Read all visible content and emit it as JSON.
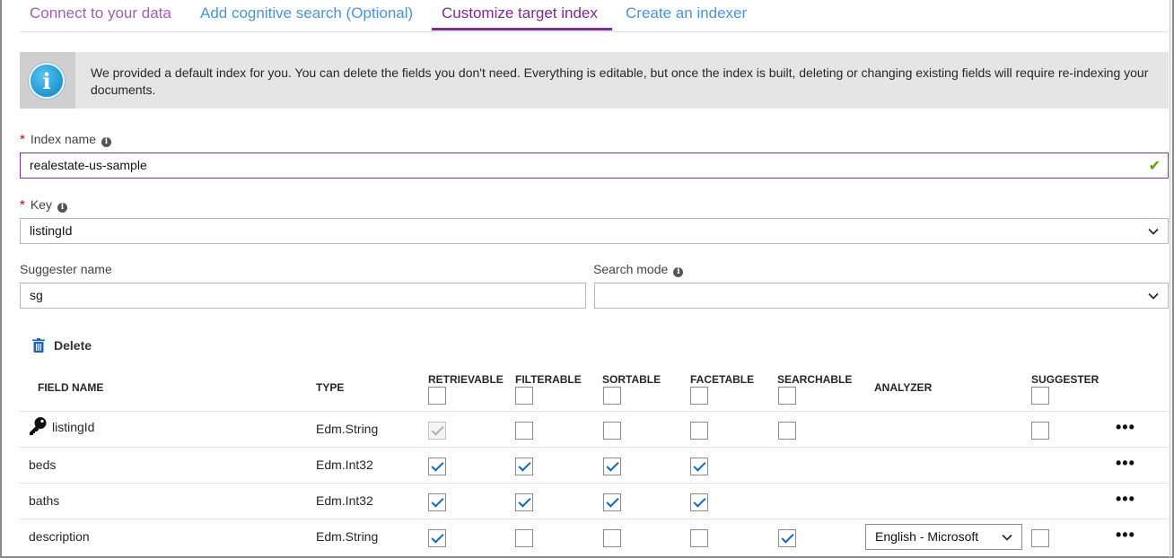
{
  "tabs": [
    {
      "label": "Connect to your data",
      "state": "visited"
    },
    {
      "label": "Add cognitive search (Optional)",
      "state": "link"
    },
    {
      "label": "Customize target index",
      "state": "active"
    },
    {
      "label": "Create an indexer",
      "state": "link"
    }
  ],
  "banner": {
    "icon": "info-icon",
    "text": "We provided a default index for you. You can delete the fields you don't need. Everything is editable, but once the index is built, deleting or changing existing fields will require re-indexing your documents."
  },
  "form": {
    "index_name": {
      "label": "Index name",
      "value": "realestate-us-sample",
      "required": true
    },
    "key": {
      "label": "Key",
      "value": "listingId",
      "required": true
    },
    "suggester_name": {
      "label": "Suggester name",
      "value": "sg"
    },
    "search_mode": {
      "label": "Search mode",
      "value": ""
    }
  },
  "toolbar": {
    "delete_label": "Delete"
  },
  "table": {
    "headers": {
      "field_name": "FIELD NAME",
      "type": "TYPE",
      "retrievable": "RETRIEVABLE",
      "filterable": "FILTERABLE",
      "sortable": "SORTABLE",
      "facetable": "FACETABLE",
      "searchable": "SEARCHABLE",
      "analyzer": "ANALYZER",
      "suggester": "SUGGESTER"
    },
    "rows": [
      {
        "name": "listingId",
        "type": "Edm.String",
        "key": true,
        "retrievable": true,
        "filterable": false,
        "sortable": false,
        "facetable": false,
        "searchable": false,
        "analyzer": "",
        "suggester": false
      },
      {
        "name": "beds",
        "type": "Edm.Int32",
        "retrievable": true,
        "filterable": true,
        "sortable": true,
        "facetable": true
      },
      {
        "name": "baths",
        "type": "Edm.Int32",
        "retrievable": true,
        "filterable": true,
        "sortable": true,
        "facetable": true
      },
      {
        "name": "description",
        "type": "Edm.String",
        "retrievable": true,
        "filterable": false,
        "sortable": false,
        "facetable": false,
        "searchable": true,
        "analyzer": "English - Microsoft",
        "suggester": false
      }
    ],
    "more_label": "•••"
  },
  "colors": {
    "accent": "#7b2d95",
    "link": "#4a95d9",
    "check": "#1565c0",
    "valid": "#57a300"
  }
}
